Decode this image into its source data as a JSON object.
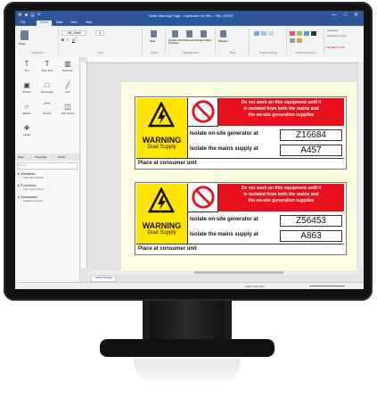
{
  "window": {
    "title": "Solar Warning Page - Lightware for Win - Title_MCEE",
    "win_controls": "— □ ✕",
    "qa_icons": "⚙ ■ 🖫 ↶"
  },
  "tabs": [
    "File",
    "Home",
    "Data",
    "View",
    "Help"
  ],
  "ribbon": {
    "groups": [
      "Clipboard",
      "Font",
      "Action",
      "Management",
      "Bars",
      "Object Settings",
      "Color Processing"
    ],
    "buttons": [
      "Paste",
      "New",
      "Dynamic Data",
      "Document Manager",
      "Object Properties",
      "Margins",
      "Insert",
      "Delete",
      "Print",
      "Preview"
    ],
    "font_name": "Ms_Shell",
    "font_size": "9",
    "right_links": [
      "Help/Ask",
      "Activate License"
    ],
    "trial_text": "Trial 30g 9 of 60"
  },
  "toolbox": [
    "Text",
    "New Text",
    "Barcode",
    "Picture",
    "Rectangle",
    "Line",
    "Ellipse",
    "Arcline",
    "Sub Shape",
    "Clipart"
  ],
  "panel_tabs": [
    "Data",
    "Properties",
    "Fields"
  ],
  "search_placeholder": "Search",
  "tree": {
    "variables": "Variables",
    "variables_sub": "Add new variable",
    "functions": "Functions",
    "functions_sub": "Add new function",
    "databases": "Databases",
    "databases_sub": "Database wizard"
  },
  "labels": [
    {
      "warning": "WARNING",
      "supply": "Dual Supply",
      "notice": [
        "Do not work on this equipment until it",
        "is isolated from both the mains and",
        "the on-site generation supplies"
      ],
      "gen_label": "Isolate on-site generator at",
      "gen_value": "Z16684",
      "mains_label": "Isolate the mains supply at",
      "mains_value": "A457",
      "footer": "Place at consumer unit"
    },
    {
      "warning": "WARNING",
      "supply": "Dual Supply",
      "notice": [
        "Do not work on this equipment until it",
        "is isolated from both the mains and",
        "the on-site generation supplies"
      ],
      "gen_label": "Isolate on-site generator at",
      "gen_value": "Z56453",
      "mains_label": "Isolate the mains supply at",
      "mains_value": "A863",
      "footer": "Place at consumer unit"
    }
  ],
  "sheet_tab": "Label Design",
  "status": {
    "zoom": "Width 73% (1/1)"
  },
  "colors": {
    "ribbon_blue": "#2b579a",
    "warning_yellow": "#ffe500",
    "notice_red": "#e8101a",
    "paper": "#fffde0"
  }
}
